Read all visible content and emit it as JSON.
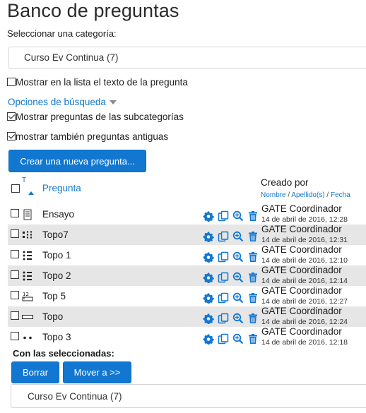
{
  "page": {
    "title": "Banco de preguntas",
    "category_label": "Seleccionar una categoría:",
    "category_value": "Curso Ev Continua (7)",
    "show_text_label": "Mostrar en la lista el texto de la pregunta",
    "search_options_label": "Opciones de búsqueda",
    "show_subcategories_label": "Mostrar preguntas de las subcategorías",
    "show_old_label": "mostrar también preguntas antiguas",
    "create_button": "Crear una nueva pregunta..."
  },
  "table": {
    "sort_letter": "T",
    "col_question": "Pregunta",
    "col_created": "Creado por",
    "sort_links": [
      "Nombre",
      "Apellido(s)",
      "Fecha"
    ],
    "rows": [
      {
        "name": "Ensayo",
        "type_icon": "essay-icon",
        "creator": "GATE Coordinador",
        "date": "14 de abril de 2016, 12:28"
      },
      {
        "name": "Topo7",
        "type_icon": "matching-icon",
        "creator": "GATE Coordinador",
        "date": "14 de abril de 2016, 12:31"
      },
      {
        "name": "Topo 1",
        "type_icon": "multichoice-icon",
        "creator": "GATE Coordinador",
        "date": "14 de abril de 2016, 12:10"
      },
      {
        "name": "Topo 2",
        "type_icon": "multichoice-icon",
        "creator": "GATE Coordinador",
        "date": "14 de abril de 2016, 12:14"
      },
      {
        "name": "Top 5",
        "type_icon": "numerical-icon",
        "creator": "GATE Coordinador",
        "date": "14 de abril de 2016, 12:27"
      },
      {
        "name": "Topo",
        "type_icon": "shortanswer-icon",
        "creator": "GATE Coordinador",
        "date": "14 de abril de 2016, 12:24"
      },
      {
        "name": "Topo 3",
        "type_icon": "truefalse-icon",
        "creator": "GATE Coordinador",
        "date": "14 de abril de 2016, 12:18"
      }
    ]
  },
  "bulk": {
    "label": "Con las seleccionadas:",
    "delete_button": "Borrar",
    "move_button": "Mover a >>",
    "move_target": "Curso Ev Continua (7)"
  },
  "colors": {
    "accent": "#1177d1",
    "row_shade": "#e6e6e6"
  }
}
